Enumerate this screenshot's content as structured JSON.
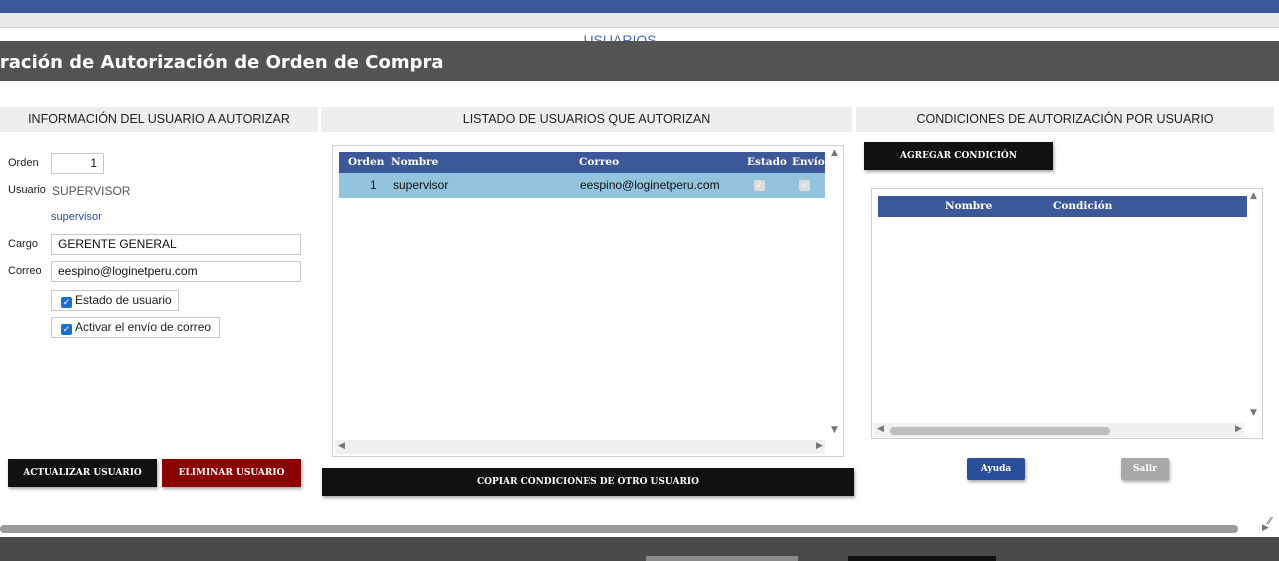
{
  "background": {
    "page_title": "USUARIOS"
  },
  "modal": {
    "title": "iguración de Autorización de Orden de Compra"
  },
  "left": {
    "heading": "INFORMACIÓN DEL USUARIO A AUTORIZAR",
    "orden_label": "Orden",
    "orden_value": "1",
    "usuario_label": "Usuario",
    "usuario_value": "SUPERVISOR",
    "usuario_sub": "supervisor",
    "cargo_label": "Cargo",
    "cargo_value": "GERENTE GENERAL",
    "correo_label": "Correo",
    "correo_value": "eespino@loginetperu.com",
    "estado_label": "Estado de usuario",
    "envio_label": "Activar el envío de correo",
    "update_button": "ACTUALIZAR USUARIO",
    "delete_button": "ELIMINAR USUARIO"
  },
  "middle": {
    "heading": "LISTADO DE USUARIOS QUE AUTORIZAN",
    "columns": [
      "Orden",
      "Nombre",
      "Correo",
      "Estado",
      "Envío"
    ],
    "rows": [
      {
        "orden": "1",
        "nombre": "supervisor",
        "correo": "eespino@loginetperu.com",
        "estado": true,
        "envio": true
      }
    ],
    "copy_button": "COPIAR CONDICIONES DE OTRO USUARIO"
  },
  "right": {
    "heading": "CONDICIONES DE AUTORIZACIÓN POR USUARIO",
    "add_button": "AGREGAR CONDICIÓN",
    "columns": [
      "Nombre",
      "Condición"
    ],
    "help_button": "Ayuda",
    "exit_button": "Salir"
  },
  "icons": {
    "checkbox_checked": "check-icon",
    "scroll_up": "arrow-up-icon",
    "scroll_down": "arrow-down-icon",
    "scroll_left": "arrow-left-icon",
    "scroll_right": "arrow-right-icon",
    "resize": "resize-grip-icon"
  },
  "colors": {
    "header_blue": "#3b5998",
    "modal_header": "#535353",
    "selected_row": "#93c4de",
    "delete_red": "#8b0000"
  }
}
